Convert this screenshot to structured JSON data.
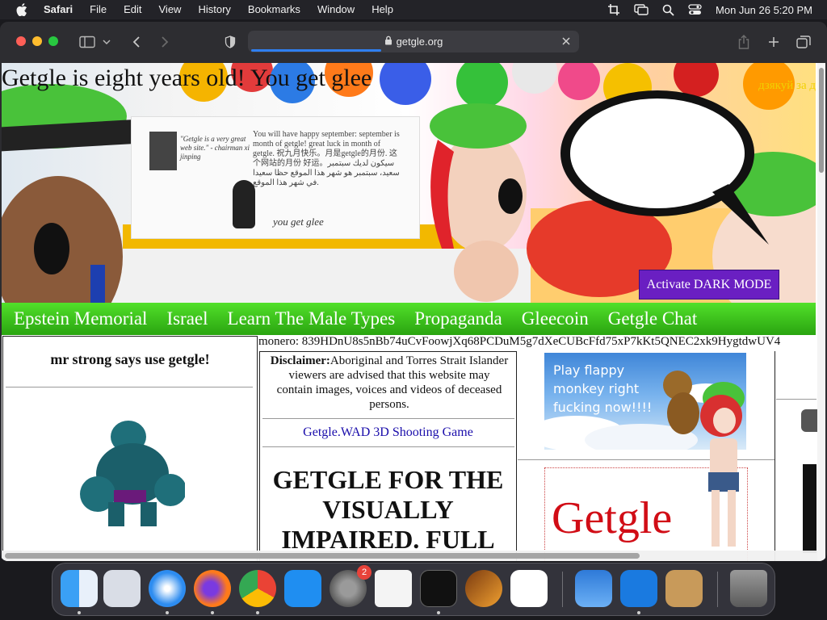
{
  "menubar": {
    "app": "Safari",
    "items": [
      "File",
      "Edit",
      "View",
      "History",
      "Bookmarks",
      "Window",
      "Help"
    ],
    "datetime": "Mon Jun 26  5:20 PM"
  },
  "browser": {
    "url": "getgle.org",
    "page_load_progress": 0.4
  },
  "page": {
    "banner_title": "Getgle is eight years old! You get glee",
    "banner_side_text": "дзякуй за д",
    "board_quote": "\"Getgle is a very great web site.\" - chairman xi jinping",
    "board_text": "You will have happy september: september is month of getgle! great luck in month of getgle. 祝九月快乐。月是getgle的月份. 这个网站的月份 好运。سيكون لديك سبتمبر سعيد، سبتمبر هو شهر هذا الموقع حظا سعيدا في شهر هذا الموقع.",
    "board_footer": "you get glee",
    "dark_mode_button": "Activate DARK MODE",
    "nav": [
      "Epstein Memorial",
      "Israel",
      "Learn The Male Types",
      "Propaganda",
      "Gleecoin",
      "Getgle Chat"
    ],
    "col1_title": "mr strong says use getgle!",
    "monero": "monero: 839HDnU8s5nBb74uCvFoowjXq68PCDuM5g7dXeCUBcFfd75xP7kKt5QNEC2xk9HygtdwUV4",
    "disclaimer_label": "Disclaimer:",
    "disclaimer_text": "Aboriginal and Torres Strait Islander viewers are advised that this website may contain images, voices and videos of deceased persons.",
    "wad_link": "Getgle.WAD 3D Shooting Game",
    "big_title": "GETGLE FOR THE VISUALLY IMPAIRED. FULL",
    "flappy_text": "Play flappy monkey right fucking now!!!!",
    "getgle_logo": "Getgle"
  },
  "dock": {
    "apps": [
      "Finder",
      "Launchpad",
      "Safari",
      "Firefox",
      "Chrome",
      "App Store",
      "System Preferences",
      "TextEdit",
      "Terminal",
      "GarageBand",
      "Visual Studio Code",
      "Weather",
      "Microsoft Remote Desktop",
      "Contacts",
      "Trash"
    ],
    "settings_badge": "2"
  }
}
